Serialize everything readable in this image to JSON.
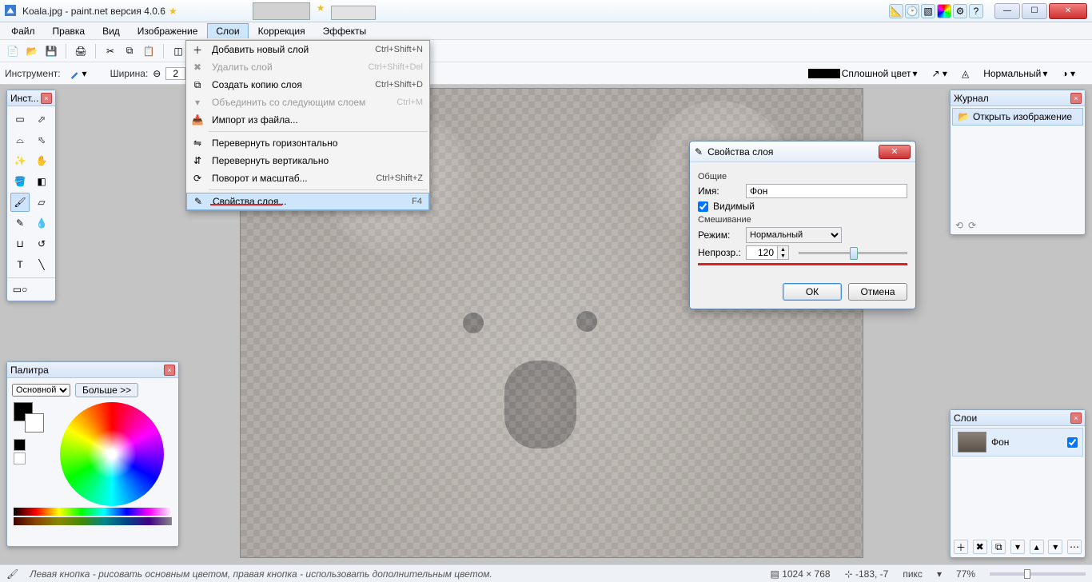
{
  "title": "Koala.jpg - paint.net версия 4.0.6",
  "menubar": [
    "Файл",
    "Правка",
    "Вид",
    "Изображение",
    "Слои",
    "Коррекция",
    "Эффекты"
  ],
  "menu_open_index": 4,
  "layers_menu": [
    {
      "label": "Добавить новый слой",
      "shortcut": "Ctrl+Shift+N",
      "disabled": false
    },
    {
      "label": "Удалить слой",
      "shortcut": "Ctrl+Shift+Del",
      "disabled": true
    },
    {
      "label": "Создать копию слоя",
      "shortcut": "Ctrl+Shift+D",
      "disabled": false
    },
    {
      "label": "Объединить со следующим слоем",
      "shortcut": "Ctrl+M",
      "disabled": true
    },
    {
      "label": "Импорт из файла...",
      "shortcut": "",
      "disabled": false
    },
    {
      "sep": true
    },
    {
      "label": "Перевернуть горизонтально",
      "shortcut": "",
      "disabled": false
    },
    {
      "label": "Перевернуть вертикально",
      "shortcut": "",
      "disabled": false
    },
    {
      "label": "Поворот и масштаб...",
      "shortcut": "Ctrl+Shift+Z",
      "disabled": false
    },
    {
      "sep": true
    },
    {
      "label": "Свойства слоя...",
      "shortcut": "F4",
      "disabled": false,
      "selected": true
    }
  ],
  "toolbar2": {
    "instrument_label": "Инструмент:",
    "width_label": "Ширина:",
    "width_value": "2",
    "fill_label": "Сплошной цвет",
    "blend_label": "Нормальный"
  },
  "tools_title": "Инст...",
  "history": {
    "title": "Журнал",
    "item": "Открыть изображение"
  },
  "layers_panel": {
    "title": "Слои",
    "layer_name": "Фон",
    "visible": true
  },
  "palette": {
    "title": "Палитра",
    "mode": "Основной",
    "more": "Больше >>"
  },
  "dialog": {
    "title": "Свойства слоя",
    "section_general": "Общие",
    "name_label": "Имя:",
    "name_value": "Фон",
    "visible_label": "Видимый",
    "section_blend": "Смешивание",
    "mode_label": "Режим:",
    "mode_value": "Нормальный",
    "opacity_label": "Непрозр.:",
    "opacity_value": "120",
    "ok": "ОК",
    "cancel": "Отмена"
  },
  "status": {
    "hint": "Левая кнопка - рисовать основным цветом, правая кнопка - использовать дополнительным цветом.",
    "dims": "1024 × 768",
    "cursor": "-183, -7",
    "units": "пикс",
    "zoom": "77%"
  },
  "util_icons": [
    "ruler-icon",
    "clock-icon",
    "layers-util-icon",
    "wheel-icon",
    "gear-icon",
    "help-icon"
  ]
}
